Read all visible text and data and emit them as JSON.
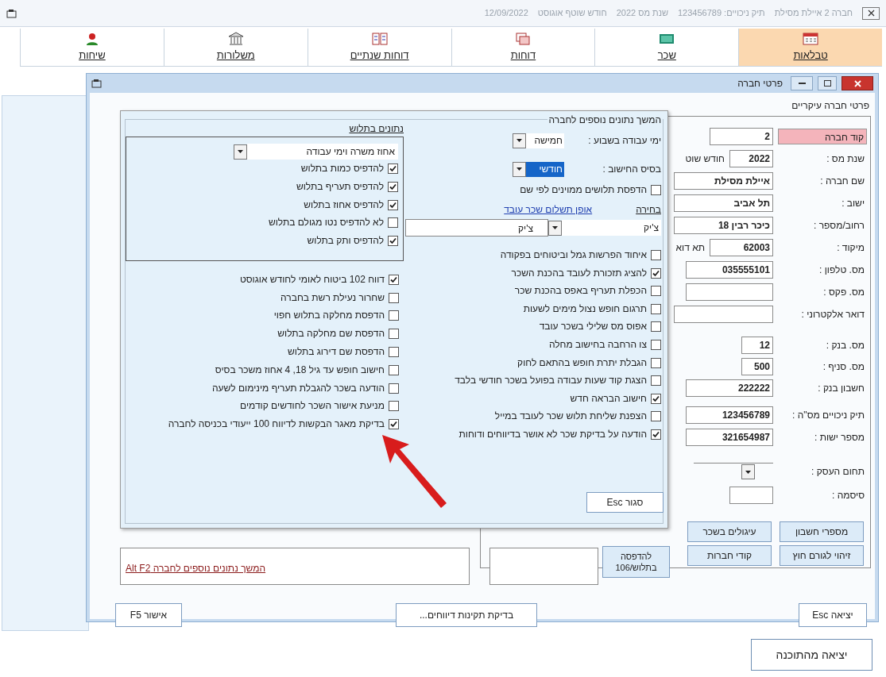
{
  "app_window": {
    "title_parts": [
      "חברה 2 איילת מסילת",
      "תיק ניכויים: 123456789",
      "שנת מס 2022",
      "חודש שוטף אוגוסט",
      "12/09/2022"
    ]
  },
  "toolbar": [
    {
      "label": "טבלאות",
      "selected": true
    },
    {
      "label": "שכר",
      "selected": false
    },
    {
      "label": "דוחות",
      "selected": false
    },
    {
      "label": "דוחות שנתיים",
      "selected": false
    },
    {
      "label": "משלורות",
      "selected": false
    },
    {
      "label": "שיחות",
      "selected": false
    }
  ],
  "dialog": {
    "title": "פרטי חברה",
    "main_details": {
      "heading": "פרטי חברה עיקריים",
      "field_groups": [
        [
          {
            "label": "קוד חברה",
            "value": "2",
            "kind": "medium",
            "highlighted": true
          },
          {
            "label": "שנת מס :",
            "value": "2022",
            "kind": "short",
            "highlighted": false,
            "side_label": "חודש שוט"
          },
          {
            "label": "שם חברה :",
            "value": "איילת מסילת",
            "kind": "full",
            "highlighted": false
          },
          {
            "label": "ישוב :",
            "value": "תל אביב",
            "kind": "full",
            "highlighted": false
          },
          {
            "label": "רחוב/מספר :",
            "value": "כיכר רבין 18",
            "kind": "full",
            "highlighted": false
          },
          {
            "label": "מיקוד :",
            "value": "62003",
            "kind": "medium",
            "highlighted": false,
            "side_label": "תא דוא"
          },
          {
            "label": "מס. טלפון :",
            "value": "035555101",
            "kind": "wide",
            "highlighted": false
          },
          {
            "label": "מס. פקס :",
            "kind": "wide",
            "highlighted": false
          },
          {
            "label": "דואר אלקטרוני :",
            "kind": "full",
            "highlighted": false
          }
        ],
        [
          {
            "label": "מס. בנק :",
            "value": "12",
            "kind": "tiny",
            "highlighted": false
          },
          {
            "label": "מס. סניף :",
            "value": "500",
            "kind": "tiny",
            "highlighted": false
          },
          {
            "label": "חשבון בנק :",
            "value": "222222",
            "kind": "wide",
            "highlighted": false
          }
        ],
        [
          {
            "label": "תיק ניכויים מס\"ה :",
            "value": "123456789",
            "kind": "wide",
            "highlighted": false
          },
          {
            "label": "מספר ישות :",
            "value": "321654987",
            "kind": "wide",
            "highlighted": false
          }
        ],
        [
          {
            "label": "תחום העסק :",
            "kind": "dropdown",
            "highlighted": false
          },
          {
            "label": "סיסמה :",
            "kind": "short",
            "highlighted": false
          }
        ]
      ],
      "buttons": [
        "מספרי חשבון",
        "עיגולים בשכר",
        "זיהוי לגורם חוץ",
        "קודי חברות"
      ],
      "print_button": "להדפסה בתלוש/106"
    },
    "link": "המשך נתונים נוספים לחברה Alt F2",
    "buttons": [
      "יציאה Esc",
      "בדיקת תקינות דיווחים...",
      "אישור F5"
    ]
  },
  "extra_panel": {
    "title": "המשך נתונים נוספים לחברה",
    "work_days": {
      "label": "ימי עבודה בשבוע :",
      "value": "חמישה"
    },
    "calc_basis": {
      "label": "בסיס החישוב :",
      "value": "חודשי"
    },
    "sort_option": {
      "label": "הדפסת תלושים ממוינים לפי שם",
      "checked": false
    },
    "payment": {
      "label": "בחירה",
      "link": "אופן תשלום שכר עובד",
      "value": "צ'יק",
      "description": "צ'יק"
    },
    "options": [
      {
        "label": "איחוד הפרשות גמל וביטוחים בפקודה",
        "checked": false
      },
      {
        "label": "להציג תזכורת לעובד בהכנת השכר",
        "checked": true
      },
      {
        "label": "הכפלת תעריף באפס בהכנת שכר",
        "checked": false
      },
      {
        "label": "תרגום חופש נצול מימים לשעות",
        "checked": false
      },
      {
        "label": "אפוס מס שלילי בשכר עובד",
        "checked": false
      },
      {
        "label": "צו הרחבה בחישוב מחלה",
        "checked": false
      },
      {
        "label": "הגבלת יתרת חופש בהתאם לחוק",
        "checked": false
      },
      {
        "label": "הצגת קוד שעות עבודה בפועל בשכר חודשי בלבד",
        "checked": false
      },
      {
        "label": "חישוב הבראה חדש",
        "checked": true
      },
      {
        "label": "הצפנת שליחת תלוש שכר לעובד במייל",
        "checked": false
      },
      {
        "label": "הודעה על בדיקת שכר לא אושר בדיווחים ודוחות",
        "checked": true
      }
    ],
    "close_button": "סגור Esc",
    "payslip": {
      "heading": "נתונים בתלוש",
      "dropdown_value": "אחוז משרה וימי עבודה",
      "checkboxes": [
        {
          "label": "להדפיס כמות בתלוש",
          "checked": true
        },
        {
          "label": "להדפיס תעריף בתלוש",
          "checked": true
        },
        {
          "label": "להדפיס אחוז בתלוש",
          "checked": true
        },
        {
          "label": "לא להדפיס נטו מגולם בתלוש",
          "checked": false
        },
        {
          "label": "להדפיס ותק בתלוש",
          "checked": true
        }
      ]
    },
    "more_options": [
      {
        "label": "דווח 102 ביטוח לאומי לחודש אוגוסט",
        "checked": true
      },
      {
        "label": "שחרור נעילת רשת בחברה",
        "checked": false
      },
      {
        "label": "הדפסת מחלקה בתלוש חפוי",
        "checked": false
      },
      {
        "label": "הדפסת שם מחלקה בתלוש",
        "checked": false
      },
      {
        "label": "הדפסת שם דירוג בתלוש",
        "checked": false
      },
      {
        "label": "חישוב חופש עד גיל 18, 4 אחוז משכר בסיס",
        "checked": false
      },
      {
        "label": "הודעה בשכר להגבלת תעריף מינימום לשעה",
        "checked": false
      },
      {
        "label": "מניעת אישור השכר לחודשים קודמים",
        "checked": false
      },
      {
        "label": "בדיקת מאגר הבקשות לדיווח 100 ייעודי בכניסה לחברה",
        "checked": true
      }
    ]
  },
  "exit_button": "יציאה מהתוכנה"
}
